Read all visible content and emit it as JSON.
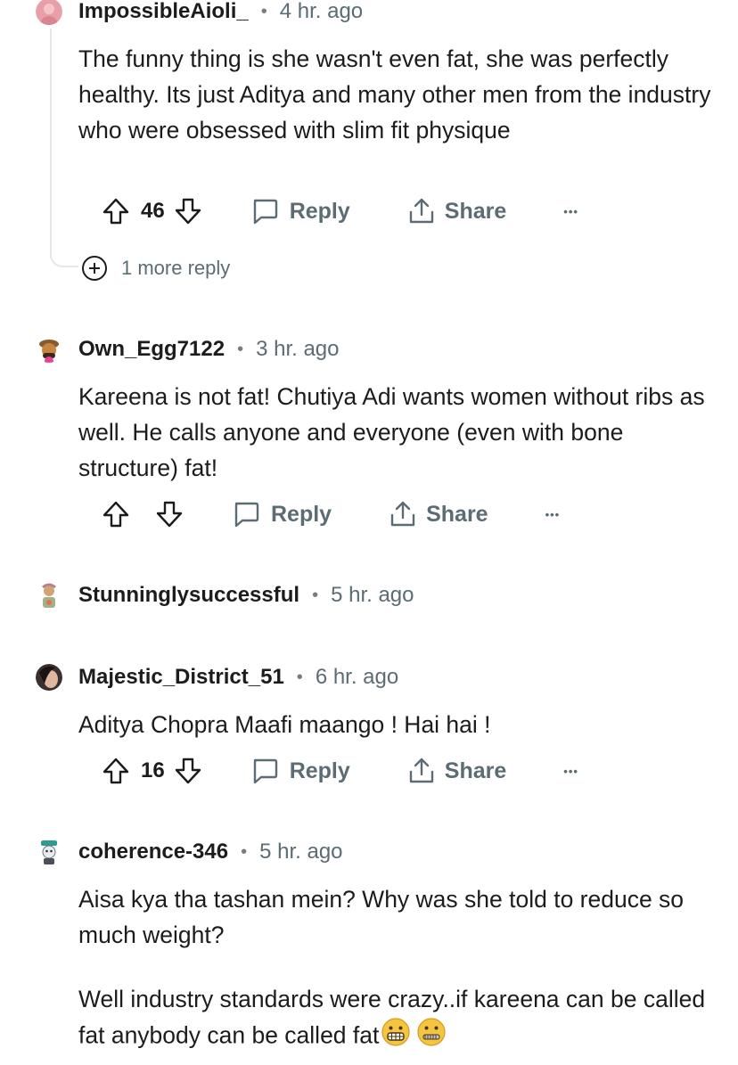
{
  "comments": [
    {
      "username": "ImpossibleAioli_",
      "time": "4 hr. ago",
      "dot": "•",
      "paragraphs": [
        "The funny thing is she wasn't even fat, she was perfectly healthy. Its just Aditya and many other men from the industry who were obsessed with slim fit physique"
      ],
      "votes": "46",
      "reply_label": "Reply",
      "share_label": "Share",
      "more_label": "•••",
      "more_replies": "1 more reply"
    },
    {
      "username": "Own_Egg7122",
      "time": "3 hr. ago",
      "dot": "•",
      "paragraphs": [
        "Kareena is not fat! Chutiya Adi wants women without ribs as well. He calls anyone and everyone (even with bone structure) fat!"
      ],
      "votes": "",
      "reply_label": "Reply",
      "share_label": "Share",
      "more_label": "•••"
    },
    {
      "username": "Stunninglysuccessful",
      "time": "5 hr. ago",
      "dot": "•"
    },
    {
      "username": "Majestic_District_51",
      "time": "6 hr. ago",
      "dot": "•",
      "paragraphs": [
        "Aditya Chopra Maafi maango ! Hai hai !"
      ],
      "votes": "16",
      "reply_label": "Reply",
      "share_label": "Share",
      "more_label": "•••"
    },
    {
      "username": "coherence-346",
      "time": "5 hr. ago",
      "dot": "•",
      "paragraphs": [
        "Aisa kya tha tashan mein? Why was she told to reduce so much weight?",
        "Well industry standards were crazy..if kareena can be called fat anybody can be called fat"
      ]
    }
  ],
  "icons": {
    "upvote": "upvote-arrow-icon",
    "downvote": "downvote-arrow-icon",
    "reply": "speech-bubble-icon",
    "share": "share-arrow-icon",
    "more": "ellipsis-icon",
    "emojis": [
      "grimacing-face-emoji",
      "zipper-mouth-face-emoji"
    ]
  },
  "colors": {
    "text": "#1c1c1c",
    "meta": "#5c6c74",
    "thread_line": "#e5e7e9"
  }
}
